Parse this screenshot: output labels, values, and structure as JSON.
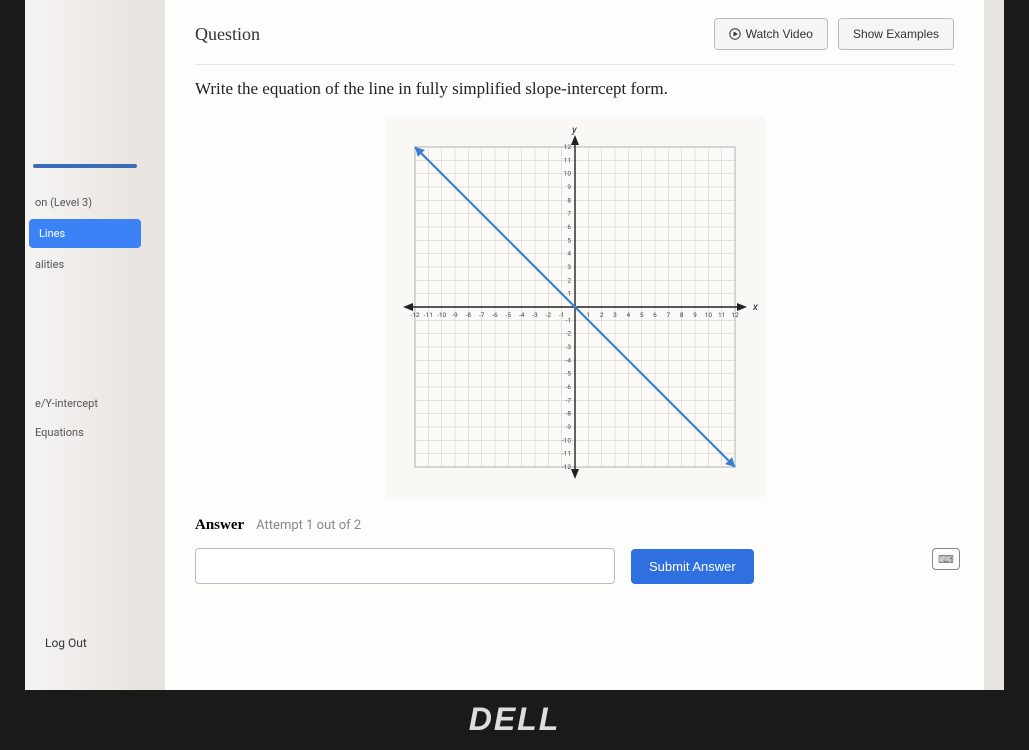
{
  "header": {
    "title": "Question",
    "watch_video": "Watch Video",
    "show_examples": "Show Examples"
  },
  "prompt": "Write the equation of the line in fully simplified slope-intercept form.",
  "sidebar": {
    "items": [
      {
        "label": "on (Level 3)"
      },
      {
        "label": "Lines"
      },
      {
        "label": "alities"
      },
      {
        "label": "e/Y-intercept"
      },
      {
        "label": "Equations"
      }
    ],
    "logout": "Log Out"
  },
  "answer": {
    "label": "Answer",
    "attempt": "Attempt 1 out of 2",
    "value": "",
    "submit": "Submit Answer"
  },
  "chart_data": {
    "type": "line",
    "title": "",
    "xlabel": "x",
    "ylabel": "y",
    "xlim": [
      -12,
      12
    ],
    "ylim": [
      -12,
      12
    ],
    "x_ticks": [
      -12,
      -11,
      -10,
      -9,
      -8,
      -7,
      -6,
      -5,
      -4,
      -3,
      -2,
      -1,
      1,
      2,
      3,
      4,
      5,
      6,
      7,
      8,
      9,
      10,
      11,
      12
    ],
    "y_ticks": [
      -12,
      -11,
      -10,
      -9,
      -8,
      -7,
      -6,
      -5,
      -4,
      -3,
      -2,
      -1,
      1,
      2,
      3,
      4,
      5,
      6,
      7,
      8,
      9,
      10,
      11,
      12
    ],
    "series": [
      {
        "name": "line",
        "points": [
          {
            "x": -12,
            "y": 12
          },
          {
            "x": 12,
            "y": -12
          }
        ],
        "slope": -1,
        "y_intercept": 0,
        "color": "#3b7fd4"
      }
    ]
  },
  "brand": "DELL",
  "help_icon": "⌨"
}
